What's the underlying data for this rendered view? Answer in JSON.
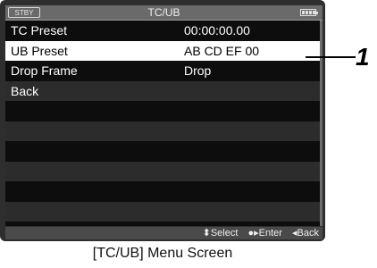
{
  "header": {
    "status": "STBY",
    "title": "TC/UB"
  },
  "menu": {
    "items": [
      {
        "label": "TC Preset",
        "value": "00:00:00.00"
      },
      {
        "label": "UB Preset",
        "value": "AB CD EF 00"
      },
      {
        "label": "Drop Frame",
        "value": "Drop"
      },
      {
        "label": "Back",
        "value": ""
      }
    ],
    "selected_index": 1
  },
  "footer": {
    "select": "⬍Select",
    "enter": "●▸Enter",
    "back": "◂Back"
  },
  "caption": "[TC/UB] Menu Screen",
  "callout": "1"
}
